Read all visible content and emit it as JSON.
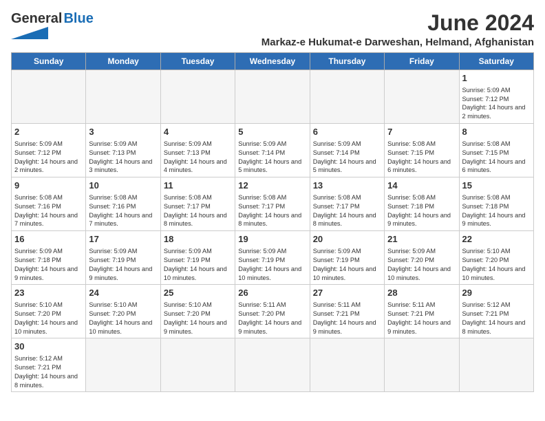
{
  "header": {
    "logo_general": "General",
    "logo_blue": "Blue",
    "title": "June 2024",
    "subtitle": "Markaz-e Hukumat-e Darweshan, Helmand, Afghanistan"
  },
  "weekdays": [
    "Sunday",
    "Monday",
    "Tuesday",
    "Wednesday",
    "Thursday",
    "Friday",
    "Saturday"
  ],
  "days": [
    {
      "num": "",
      "sunrise": "",
      "sunset": "",
      "daylight": ""
    },
    {
      "num": "",
      "sunrise": "",
      "sunset": "",
      "daylight": ""
    },
    {
      "num": "",
      "sunrise": "",
      "sunset": "",
      "daylight": ""
    },
    {
      "num": "",
      "sunrise": "",
      "sunset": "",
      "daylight": ""
    },
    {
      "num": "",
      "sunrise": "",
      "sunset": "",
      "daylight": ""
    },
    {
      "num": "",
      "sunrise": "",
      "sunset": "",
      "daylight": ""
    },
    {
      "num": "1",
      "sunrise": "Sunrise: 5:09 AM",
      "sunset": "Sunset: 7:12 PM",
      "daylight": "Daylight: 14 hours and 2 minutes."
    },
    {
      "num": "2",
      "sunrise": "Sunrise: 5:09 AM",
      "sunset": "Sunset: 7:12 PM",
      "daylight": "Daylight: 14 hours and 2 minutes."
    },
    {
      "num": "3",
      "sunrise": "Sunrise: 5:09 AM",
      "sunset": "Sunset: 7:13 PM",
      "daylight": "Daylight: 14 hours and 3 minutes."
    },
    {
      "num": "4",
      "sunrise": "Sunrise: 5:09 AM",
      "sunset": "Sunset: 7:13 PM",
      "daylight": "Daylight: 14 hours and 4 minutes."
    },
    {
      "num": "5",
      "sunrise": "Sunrise: 5:09 AM",
      "sunset": "Sunset: 7:14 PM",
      "daylight": "Daylight: 14 hours and 5 minutes."
    },
    {
      "num": "6",
      "sunrise": "Sunrise: 5:09 AM",
      "sunset": "Sunset: 7:14 PM",
      "daylight": "Daylight: 14 hours and 5 minutes."
    },
    {
      "num": "7",
      "sunrise": "Sunrise: 5:08 AM",
      "sunset": "Sunset: 7:15 PM",
      "daylight": "Daylight: 14 hours and 6 minutes."
    },
    {
      "num": "8",
      "sunrise": "Sunrise: 5:08 AM",
      "sunset": "Sunset: 7:15 PM",
      "daylight": "Daylight: 14 hours and 6 minutes."
    },
    {
      "num": "9",
      "sunrise": "Sunrise: 5:08 AM",
      "sunset": "Sunset: 7:16 PM",
      "daylight": "Daylight: 14 hours and 7 minutes."
    },
    {
      "num": "10",
      "sunrise": "Sunrise: 5:08 AM",
      "sunset": "Sunset: 7:16 PM",
      "daylight": "Daylight: 14 hours and 7 minutes."
    },
    {
      "num": "11",
      "sunrise": "Sunrise: 5:08 AM",
      "sunset": "Sunset: 7:17 PM",
      "daylight": "Daylight: 14 hours and 8 minutes."
    },
    {
      "num": "12",
      "sunrise": "Sunrise: 5:08 AM",
      "sunset": "Sunset: 7:17 PM",
      "daylight": "Daylight: 14 hours and 8 minutes."
    },
    {
      "num": "13",
      "sunrise": "Sunrise: 5:08 AM",
      "sunset": "Sunset: 7:17 PM",
      "daylight": "Daylight: 14 hours and 8 minutes."
    },
    {
      "num": "14",
      "sunrise": "Sunrise: 5:08 AM",
      "sunset": "Sunset: 7:18 PM",
      "daylight": "Daylight: 14 hours and 9 minutes."
    },
    {
      "num": "15",
      "sunrise": "Sunrise: 5:08 AM",
      "sunset": "Sunset: 7:18 PM",
      "daylight": "Daylight: 14 hours and 9 minutes."
    },
    {
      "num": "16",
      "sunrise": "Sunrise: 5:09 AM",
      "sunset": "Sunset: 7:18 PM",
      "daylight": "Daylight: 14 hours and 9 minutes."
    },
    {
      "num": "17",
      "sunrise": "Sunrise: 5:09 AM",
      "sunset": "Sunset: 7:19 PM",
      "daylight": "Daylight: 14 hours and 9 minutes."
    },
    {
      "num": "18",
      "sunrise": "Sunrise: 5:09 AM",
      "sunset": "Sunset: 7:19 PM",
      "daylight": "Daylight: 14 hours and 10 minutes."
    },
    {
      "num": "19",
      "sunrise": "Sunrise: 5:09 AM",
      "sunset": "Sunset: 7:19 PM",
      "daylight": "Daylight: 14 hours and 10 minutes."
    },
    {
      "num": "20",
      "sunrise": "Sunrise: 5:09 AM",
      "sunset": "Sunset: 7:19 PM",
      "daylight": "Daylight: 14 hours and 10 minutes."
    },
    {
      "num": "21",
      "sunrise": "Sunrise: 5:09 AM",
      "sunset": "Sunset: 7:20 PM",
      "daylight": "Daylight: 14 hours and 10 minutes."
    },
    {
      "num": "22",
      "sunrise": "Sunrise: 5:10 AM",
      "sunset": "Sunset: 7:20 PM",
      "daylight": "Daylight: 14 hours and 10 minutes."
    },
    {
      "num": "23",
      "sunrise": "Sunrise: 5:10 AM",
      "sunset": "Sunset: 7:20 PM",
      "daylight": "Daylight: 14 hours and 10 minutes."
    },
    {
      "num": "24",
      "sunrise": "Sunrise: 5:10 AM",
      "sunset": "Sunset: 7:20 PM",
      "daylight": "Daylight: 14 hours and 10 minutes."
    },
    {
      "num": "25",
      "sunrise": "Sunrise: 5:10 AM",
      "sunset": "Sunset: 7:20 PM",
      "daylight": "Daylight: 14 hours and 9 minutes."
    },
    {
      "num": "26",
      "sunrise": "Sunrise: 5:11 AM",
      "sunset": "Sunset: 7:20 PM",
      "daylight": "Daylight: 14 hours and 9 minutes."
    },
    {
      "num": "27",
      "sunrise": "Sunrise: 5:11 AM",
      "sunset": "Sunset: 7:21 PM",
      "daylight": "Daylight: 14 hours and 9 minutes."
    },
    {
      "num": "28",
      "sunrise": "Sunrise: 5:11 AM",
      "sunset": "Sunset: 7:21 PM",
      "daylight": "Daylight: 14 hours and 9 minutes."
    },
    {
      "num": "29",
      "sunrise": "Sunrise: 5:12 AM",
      "sunset": "Sunset: 7:21 PM",
      "daylight": "Daylight: 14 hours and 8 minutes."
    },
    {
      "num": "30",
      "sunrise": "Sunrise: 5:12 AM",
      "sunset": "Sunset: 7:21 PM",
      "daylight": "Daylight: 14 hours and 8 minutes."
    }
  ],
  "colors": {
    "header_bg": "#2e6db4",
    "header_text": "#ffffff",
    "accent": "#1a6db5"
  }
}
